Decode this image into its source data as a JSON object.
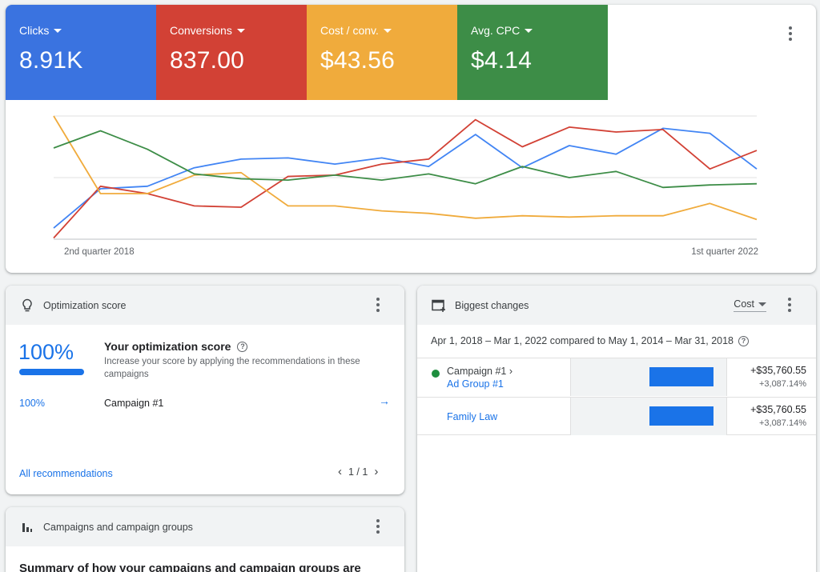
{
  "metrics": [
    {
      "label": "Clicks",
      "value": "8.91K",
      "color": "#3a73e0"
    },
    {
      "label": "Conversions",
      "value": "837.00",
      "color": "#d24135"
    },
    {
      "label": "Cost / conv.",
      "value": "$43.56",
      "color": "#f0ab3c"
    },
    {
      "label": "Avg. CPC",
      "value": "$4.14",
      "color": "#3d8d47"
    }
  ],
  "chart_data": {
    "type": "line",
    "x_start_label": "2nd quarter 2018",
    "x_end_label": "1st quarter 2022",
    "ylim": [
      0,
      1
    ],
    "grid": true,
    "series": [
      {
        "color": "#4285f4",
        "values": [
          0.09,
          0.41,
          0.43,
          0.58,
          0.65,
          0.66,
          0.61,
          0.66,
          0.59,
          0.85,
          0.58,
          0.76,
          0.69,
          0.9,
          0.86,
          0.57
        ]
      },
      {
        "color": "#d24135",
        "values": [
          0.01,
          0.43,
          0.37,
          0.27,
          0.26,
          0.51,
          0.52,
          0.61,
          0.65,
          0.97,
          0.75,
          0.91,
          0.87,
          0.89,
          0.57,
          0.72
        ]
      },
      {
        "color": "#f0ab3c",
        "values": [
          1.0,
          0.37,
          0.37,
          0.52,
          0.54,
          0.27,
          0.27,
          0.23,
          0.21,
          0.17,
          0.19,
          0.18,
          0.19,
          0.19,
          0.29,
          0.16
        ]
      },
      {
        "color": "#3d8d47",
        "values": [
          0.74,
          0.88,
          0.73,
          0.53,
          0.49,
          0.48,
          0.52,
          0.48,
          0.53,
          0.45,
          0.59,
          0.5,
          0.55,
          0.42,
          0.44,
          0.45
        ]
      }
    ]
  },
  "optimization": {
    "header": "Optimization score",
    "score": "100%",
    "title": "Your optimization score",
    "help": "?",
    "description": "Increase your score by applying the recommendations in these campaigns",
    "campaign_pct": "100%",
    "campaign_name": "Campaign #1",
    "arrow": "→",
    "all_link": "All recommendations",
    "pager_prev": "‹",
    "pager_text": "1 / 1",
    "pager_next": "›"
  },
  "campaigns_card": {
    "header": "Campaigns and campaign groups",
    "summary": "Summary of how your campaigns and campaign groups are"
  },
  "changes": {
    "header": "Biggest changes",
    "metric_select": "Cost",
    "date_range": "Apr 1, 2018 – Mar 1, 2022 compared to May 1, 2014 – Mar 31, 2018",
    "help": "?",
    "rows": [
      {
        "name": "Campaign #1 ›",
        "sub": "Ad Group #1",
        "amount": "+$35,760.55",
        "pct": "+3,087.14%"
      },
      {
        "link": "Family Law",
        "amount": "+$35,760.55",
        "pct": "+3,087.14%"
      }
    ]
  }
}
